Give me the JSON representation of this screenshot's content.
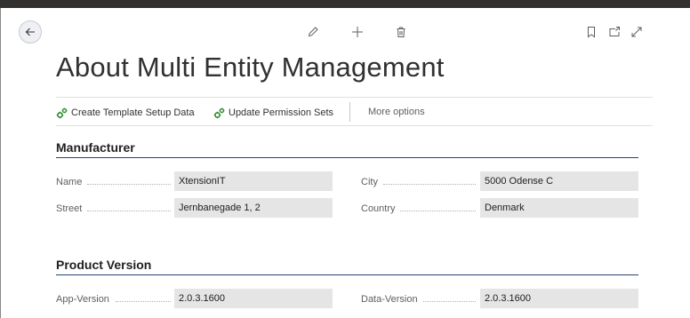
{
  "header": {
    "title": "About Multi Entity Management"
  },
  "actions": {
    "create_template": "Create Template Setup Data",
    "update_permissions": "Update Permission Sets",
    "more_options": "More options"
  },
  "manufacturer": {
    "heading": "Manufacturer",
    "name_label": "Name",
    "name_value": "XtensionIT",
    "street_label": "Street",
    "street_value": "Jernbanegade 1, 2",
    "city_label": "City",
    "city_value": "5000 Odense C",
    "country_label": "Country",
    "country_value": "Denmark"
  },
  "product_version": {
    "heading": "Product Version",
    "app_version_label": "App-Version",
    "app_version_value": "2.0.3.1600",
    "data_version_label": "Data-Version",
    "data_version_value": "2.0.3.1600"
  },
  "icons": {
    "back": "arrow-left-icon",
    "edit": "pencil-icon",
    "new": "plus-icon",
    "delete": "trash-icon",
    "bookmark": "bookmark-icon",
    "open_new": "open-in-new-window-icon",
    "expand": "expand-icon",
    "action": "gears-icon"
  },
  "colors": {
    "action_icon": "#2e8a2e",
    "section_rule": "#00205b",
    "field_bg": "#e5e5e5"
  }
}
